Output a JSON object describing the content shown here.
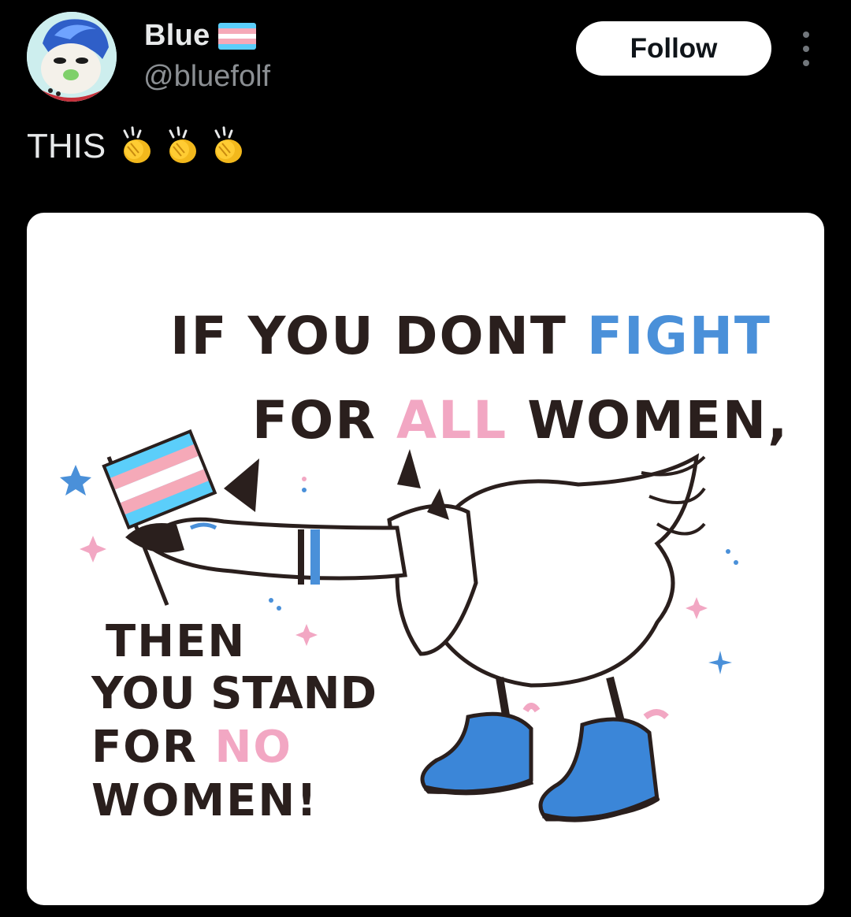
{
  "author": {
    "display_name": "Blue",
    "handle": "@bluefolf",
    "flag_icon": "transgender-flag-icon",
    "avatar_icon": "wolf-character-avatar"
  },
  "actions": {
    "follow_label": "Follow",
    "more_icon": "more-vertical-icon"
  },
  "post": {
    "text": "THIS",
    "emoji": [
      "clapping-hands-icon",
      "clapping-hands-icon",
      "clapping-hands-icon"
    ]
  },
  "media": {
    "headline_1_a": "IF YOU DONT",
    "headline_1_b": "FIGHT",
    "headline_2_a": "FOR",
    "headline_2_b": "ALL",
    "headline_2_c": "WOMEN,",
    "bottom_1": "THEN",
    "bottom_2": "YOU STAND",
    "bottom_3_a": "FOR",
    "bottom_3_b": "NO",
    "bottom_4": "WOMEN!"
  },
  "colors": {
    "background": "#000000",
    "trans_blue": "#5BCEFA",
    "trans_pink": "#F5A9B8",
    "accent_blue": "#4a90d9",
    "accent_pink": "#f2a7c3",
    "boot_blue": "#3b86d8"
  }
}
